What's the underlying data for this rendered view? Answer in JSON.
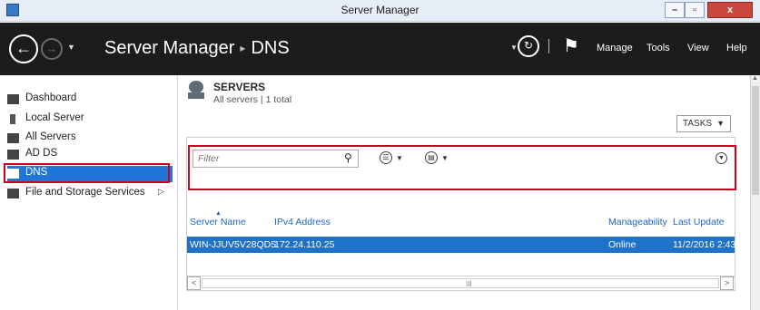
{
  "window": {
    "title": "Server Manager"
  },
  "header": {
    "breadcrumb_root": "Server Manager",
    "breadcrumb_sep": "▸",
    "breadcrumb_current": "DNS",
    "menus": [
      "Manage",
      "Tools",
      "View",
      "Help"
    ]
  },
  "sidebar": {
    "items": [
      {
        "label": "Dashboard",
        "icon": "dashboard-icon"
      },
      {
        "label": "Local Server",
        "icon": "server-icon"
      },
      {
        "label": "All Servers",
        "icon": "servers-icon"
      },
      {
        "label": "AD DS",
        "icon": "ad-ds-icon"
      },
      {
        "label": "DNS",
        "icon": "dns-icon",
        "selected": true
      },
      {
        "label": "File and Storage Services",
        "icon": "storage-icon"
      }
    ]
  },
  "servers": {
    "title": "SERVERS",
    "subtitle": "All servers | 1 total",
    "tasks_label": "TASKS",
    "filter_placeholder": "Filter",
    "columns": [
      "Server Name",
      "IPv4 Address",
      "Manageability",
      "Last Update"
    ],
    "rows": [
      {
        "name": "WIN-JJUV5V28QD5",
        "ip": "172.24.110.25",
        "manageability": "Online",
        "last_update": "11/2/2016 2:43"
      }
    ],
    "scroll_grip": "III"
  },
  "colors": {
    "header_bg": "#1c1c1c",
    "selection": "#1e72c8",
    "highlight": "#d1001c",
    "link": "#1b65c8"
  }
}
